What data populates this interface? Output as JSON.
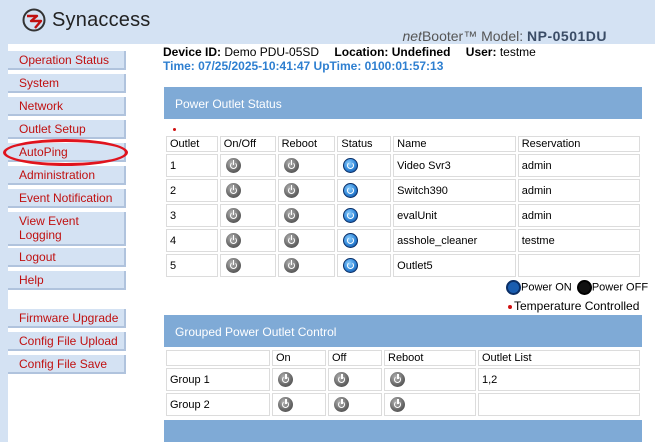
{
  "header": {
    "logo_text": "Synaccess",
    "brand": "net",
    "brand_rest": "Booter™",
    "model_label": " Model: ",
    "model_value": "NP-0501DU"
  },
  "sidebar": {
    "items": [
      {
        "label": "Operation Status"
      },
      {
        "label": "System"
      },
      {
        "label": "Network"
      },
      {
        "label": "Outlet Setup"
      },
      {
        "label": "AutoPing"
      },
      {
        "label": "Administration"
      },
      {
        "label": "Event Notification"
      },
      {
        "label": "View Event Logging"
      },
      {
        "label": "Logout"
      },
      {
        "label": "Help"
      },
      {
        "label": "Firmware Upgrade"
      },
      {
        "label": "Config File Upload"
      },
      {
        "label": "Config File Save"
      }
    ]
  },
  "info": {
    "device_id_label": "Device ID:",
    "device_id": "Demo PDU-05SD",
    "location_label": "Location:",
    "location": "Undefined",
    "user_label": "User:",
    "user": "testme",
    "time_line": "Time: 07/25/2025-10:41:47 UpTime: 0100:01:57:13"
  },
  "outlet_status": {
    "title": "Power Outlet Status",
    "headers": [
      "Outlet",
      "On/Off",
      "Reboot",
      "Status",
      "Name",
      "Reservation"
    ],
    "rows": [
      {
        "outlet": "1",
        "name": "Video Svr3",
        "reservation": "admin"
      },
      {
        "outlet": "2",
        "name": "Switch390",
        "reservation": "admin"
      },
      {
        "outlet": "3",
        "name": "evalUnit",
        "reservation": "admin"
      },
      {
        "outlet": "4",
        "name": "asshole_cleaner",
        "reservation": "testme"
      },
      {
        "outlet": "5",
        "name": "Outlet5",
        "reservation": ""
      }
    ],
    "legend_on": "Power ON",
    "legend_off": "Power OFF",
    "temp_note": "Temperature Controlled"
  },
  "grouped": {
    "title": "Grouped Power Outlet Control",
    "headers": [
      "",
      "On",
      "Off",
      "Reboot",
      "Outlet List"
    ],
    "rows": [
      {
        "group": "Group 1",
        "outlets": "1,2"
      },
      {
        "group": "Group 2",
        "outlets": ""
      }
    ]
  },
  "icons": {
    "power_button": "power-icon",
    "status_on": "status-on-icon",
    "logo": "synaccess-logo-icon"
  },
  "colors": {
    "header_bg": "#d4e2f3",
    "panel_bar": "#7faad6",
    "nav_text": "#c01010",
    "time_text": "#2e7fd0",
    "highlight": "#e0141e"
  }
}
